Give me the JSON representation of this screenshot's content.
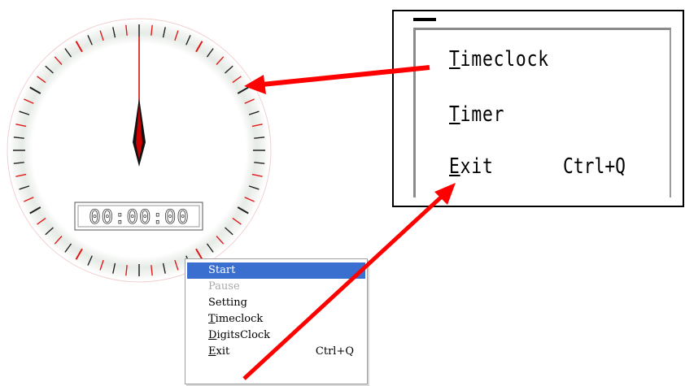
{
  "clock": {
    "digital_time": "00:00:00",
    "colors": {
      "tick_dark": "#202020",
      "tick_red": "#e01818",
      "hand_dark": "#101010",
      "hand_red": "#cc0000",
      "ring": "#e8ece8"
    }
  },
  "context_menu": {
    "items": [
      {
        "label": "Start",
        "state": "highlighted"
      },
      {
        "label": "Pause",
        "state": "disabled"
      },
      {
        "label": "Setting",
        "state": "normal"
      },
      {
        "label": "Timeclock",
        "state": "normal"
      },
      {
        "label": "DigitsClock",
        "state": "normal"
      },
      {
        "label": "Exit",
        "state": "normal",
        "shortcut": "Ctrl+Q"
      }
    ],
    "highlight_color": "#3a6fd0"
  },
  "zoom_callout": {
    "items": [
      {
        "label": "Timeclock"
      },
      {
        "label": "Timer"
      },
      {
        "label": "Exit",
        "shortcut": "Ctrl+Q"
      }
    ]
  },
  "annotation_color": "#ff0000"
}
